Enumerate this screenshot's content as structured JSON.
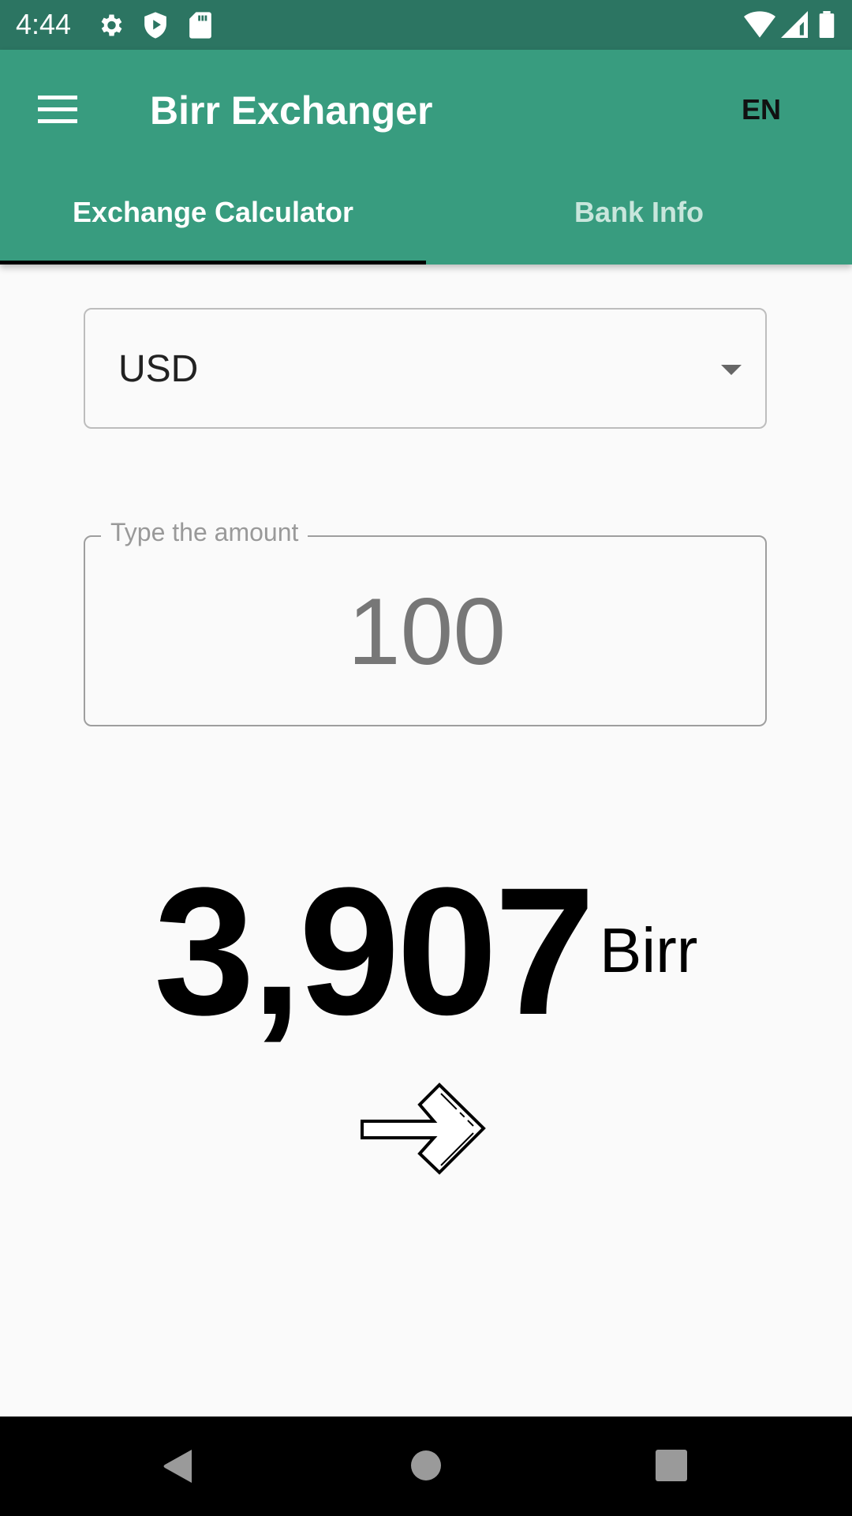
{
  "status_bar": {
    "time": "4:44",
    "icons": [
      "settings-icon",
      "shield-play-icon",
      "sd-card-icon",
      "wifi-icon",
      "signal-icon",
      "battery-icon"
    ]
  },
  "app_bar": {
    "title": "Birr Exchanger",
    "language": "EN",
    "menu_icon": "hamburger-menu-icon"
  },
  "tabs": [
    {
      "label": "Exchange Calculator",
      "selected": true
    },
    {
      "label": "Bank Info",
      "selected": false
    }
  ],
  "currency_select": {
    "value": "USD"
  },
  "amount_field": {
    "label": "Type the amount",
    "value": "100"
  },
  "result": {
    "value": "3,907",
    "unit": "Birr"
  },
  "arrow_icon": "right-arrow-icon",
  "nav_bar": {
    "buttons": [
      "back",
      "home",
      "recents"
    ]
  },
  "colors": {
    "status_bar": "#2c7562",
    "app_bar": "#389c7f",
    "indicator": "#000000",
    "background": "#fafafa"
  }
}
